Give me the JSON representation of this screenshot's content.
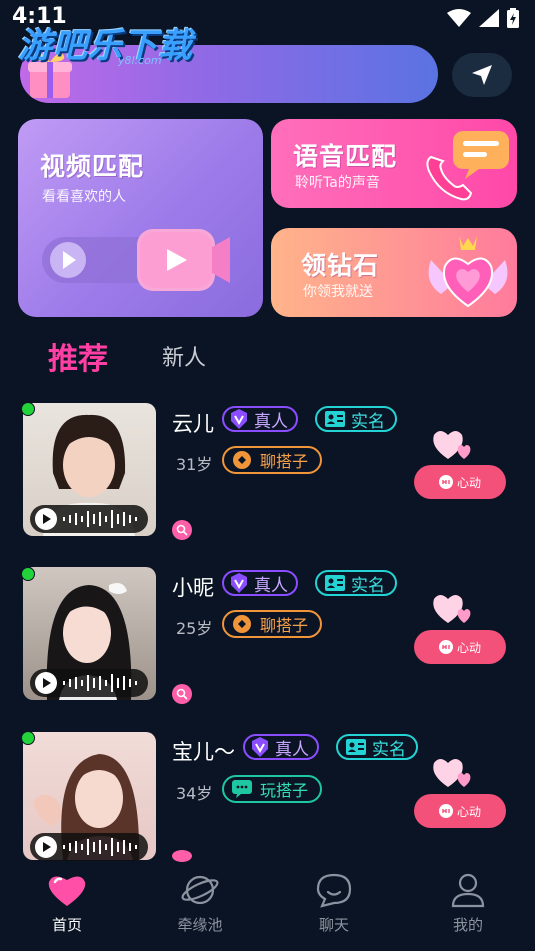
{
  "status_bar": {
    "time": "4:11"
  },
  "watermark": {
    "text": "游吧乐下载",
    "sub": "y8l.com"
  },
  "features": {
    "video": {
      "title": "视频匹配",
      "subtitle": "看看喜欢的人"
    },
    "voice": {
      "title": "语音匹配",
      "subtitle": "聆听Ta的声音"
    },
    "diamond": {
      "title": "领钻石",
      "subtitle": "你领我就送"
    }
  },
  "tabs": [
    {
      "label": "推荐",
      "active": true
    },
    {
      "label": "新人",
      "active": false
    }
  ],
  "users": [
    {
      "name": "云儿",
      "real_tag": "真人",
      "id_tag": "实名",
      "age": "31岁",
      "activity": "聊搭子",
      "action": "心动",
      "online": true
    },
    {
      "name": "小昵",
      "real_tag": "真人",
      "id_tag": "实名",
      "age": "25岁",
      "activity": "聊搭子",
      "action": "心动",
      "online": true
    },
    {
      "name": "宝儿～",
      "real_tag": "真人",
      "id_tag": "实名",
      "age": "34岁",
      "activity": "玩搭子",
      "action": "心动",
      "online": true
    }
  ],
  "nav": [
    {
      "label": "首页",
      "icon": "heart-icon",
      "active": true
    },
    {
      "label": "牵缘池",
      "icon": "planet-icon",
      "active": false
    },
    {
      "label": "聊天",
      "icon": "chat-bubble-icon",
      "active": false
    },
    {
      "label": "我的",
      "icon": "person-icon",
      "active": false
    }
  ],
  "colors": {
    "accent_pink": "#ff3fa4",
    "bg": "#0b1424",
    "online": "#22d33a"
  }
}
